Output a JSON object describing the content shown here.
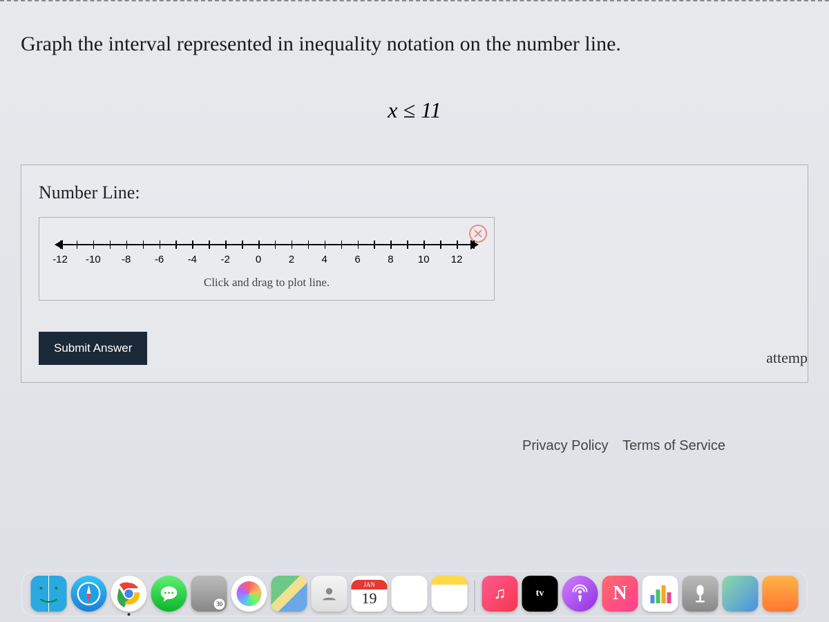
{
  "question": {
    "title": "Graph the interval represented in inequality notation on the number line.",
    "inequality": "x ≤ 11",
    "section_label": "Number Line:",
    "hint": "Click and drag to plot line.",
    "submit_label": "Submit Answer",
    "attempt_text": "attemp"
  },
  "numberline": {
    "min": -12,
    "max": 13,
    "labels": [
      -12,
      -10,
      -8,
      -6,
      -4,
      -2,
      0,
      2,
      4,
      6,
      8,
      10,
      12
    ]
  },
  "footer": {
    "privacy": "Privacy Policy",
    "terms": "Terms of Service"
  },
  "dock": {
    "calendar_month": "JAN",
    "calendar_day": "19",
    "tv_label": "tv"
  }
}
